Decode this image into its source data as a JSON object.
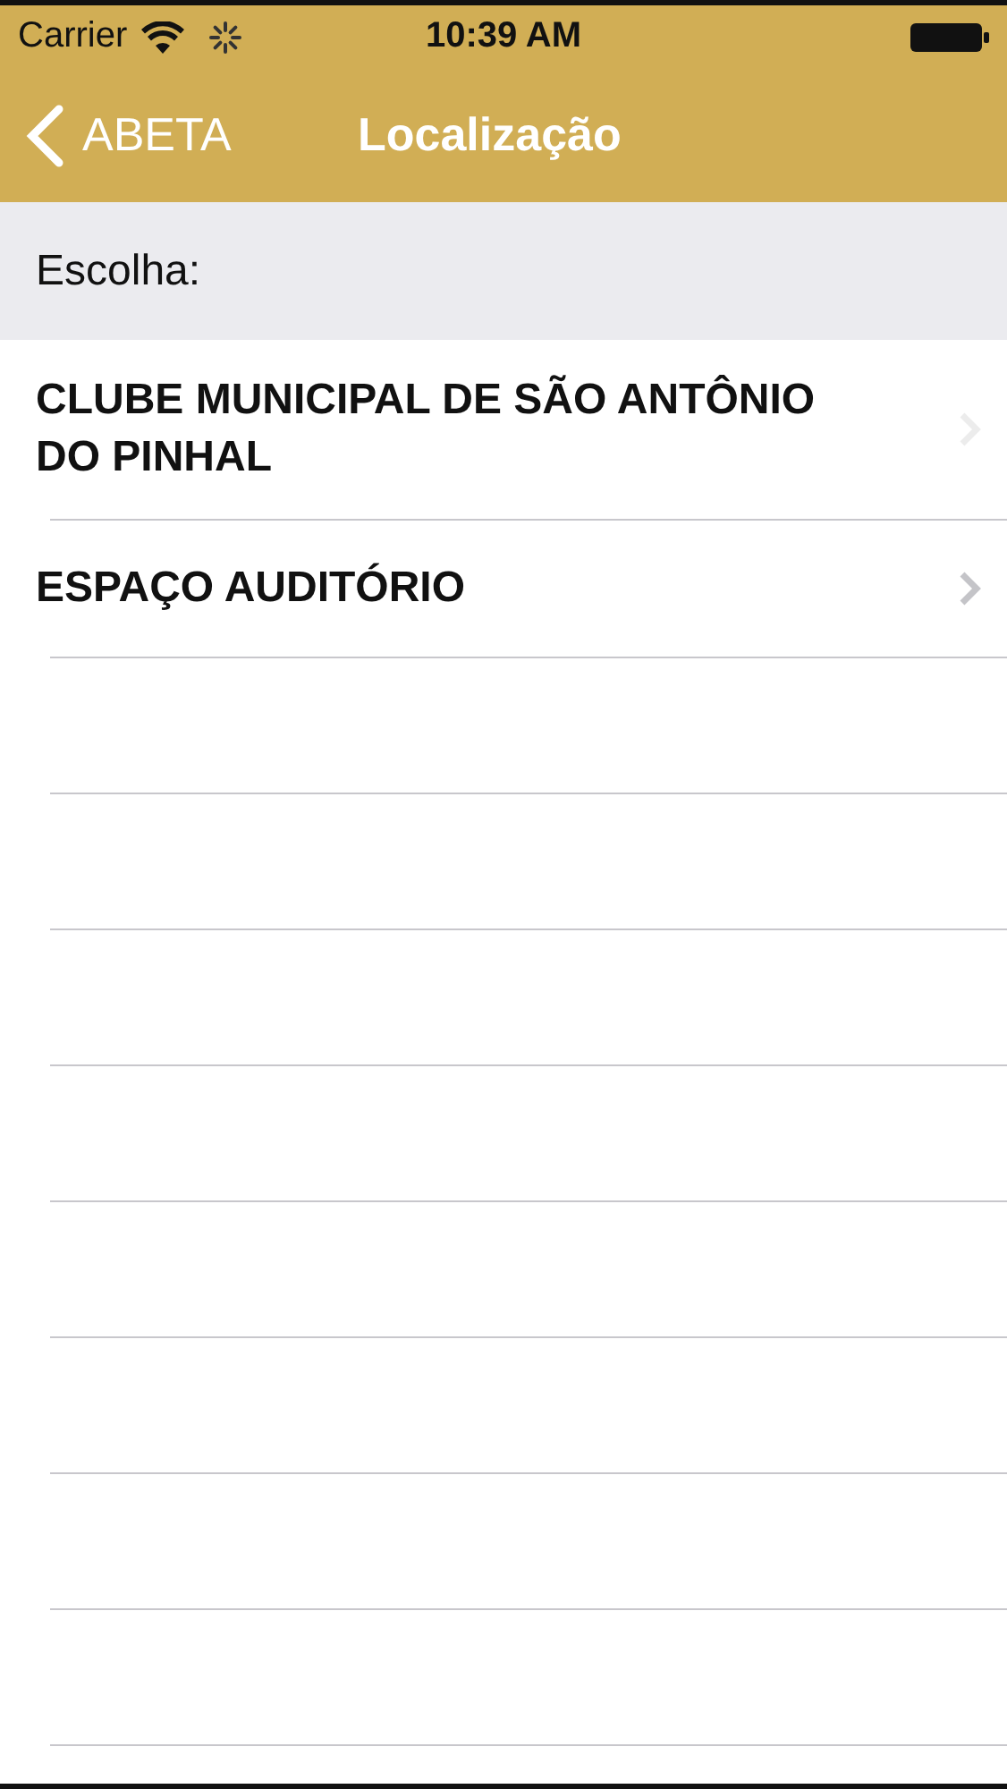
{
  "status_bar": {
    "carrier": "Carrier",
    "time": "10:39 AM"
  },
  "nav_bar": {
    "back": "ABETA",
    "title": "Localização"
  },
  "section_header": "Escolha:",
  "rows": [
    {
      "label": "CLUBE MUNICIPAL DE SÃO ANTÔNIO DO PINHAL"
    },
    {
      "label": "ESPAÇO AUDITÓRIO"
    }
  ]
}
